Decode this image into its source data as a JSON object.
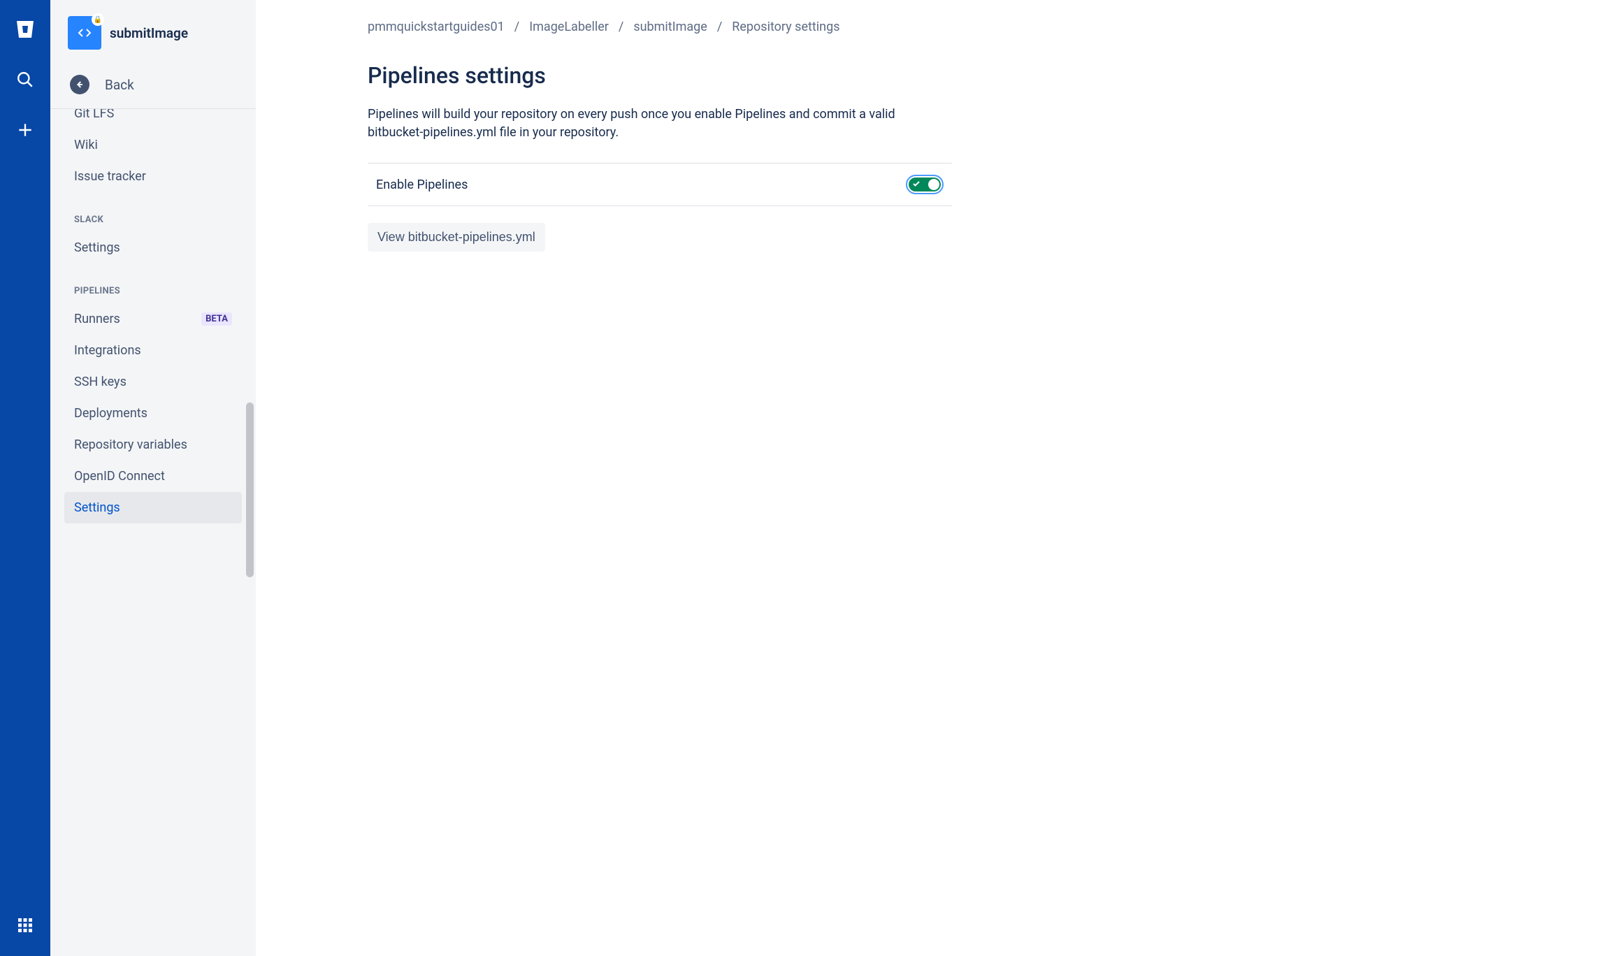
{
  "globalNav": {
    "logo": "bitbucket-logo",
    "search": "search-icon",
    "create": "plus-icon",
    "apps": "apps-icon"
  },
  "sidebar": {
    "repoName": "submitImage",
    "backLabel": "Back",
    "items": [
      {
        "label": "Git LFS",
        "badge": null
      },
      {
        "label": "Wiki",
        "badge": null
      },
      {
        "label": "Issue tracker",
        "badge": null
      }
    ],
    "slackHeader": "SLACK",
    "slackItems": [
      {
        "label": "Settings"
      }
    ],
    "pipelinesHeader": "PIPELINES",
    "pipelinesItems": [
      {
        "label": "Runners",
        "badge": "BETA"
      },
      {
        "label": "Integrations",
        "badge": null
      },
      {
        "label": "SSH keys",
        "badge": null
      },
      {
        "label": "Deployments",
        "badge": null
      },
      {
        "label": "Repository variables",
        "badge": null
      },
      {
        "label": "OpenID Connect",
        "badge": null
      },
      {
        "label": "Settings",
        "badge": null,
        "selected": true
      }
    ]
  },
  "breadcrumb": {
    "items": [
      "pmmquickstartguides01",
      "ImageLabeller",
      "submitImage",
      "Repository settings"
    ]
  },
  "page": {
    "title": "Pipelines settings",
    "description": "Pipelines will build your repository on every push once you enable Pipelines and commit a valid bitbucket-pipelines.yml file in your repository.",
    "enableLabel": "Enable Pipelines",
    "viewButton": "View bitbucket-pipelines.yml"
  }
}
